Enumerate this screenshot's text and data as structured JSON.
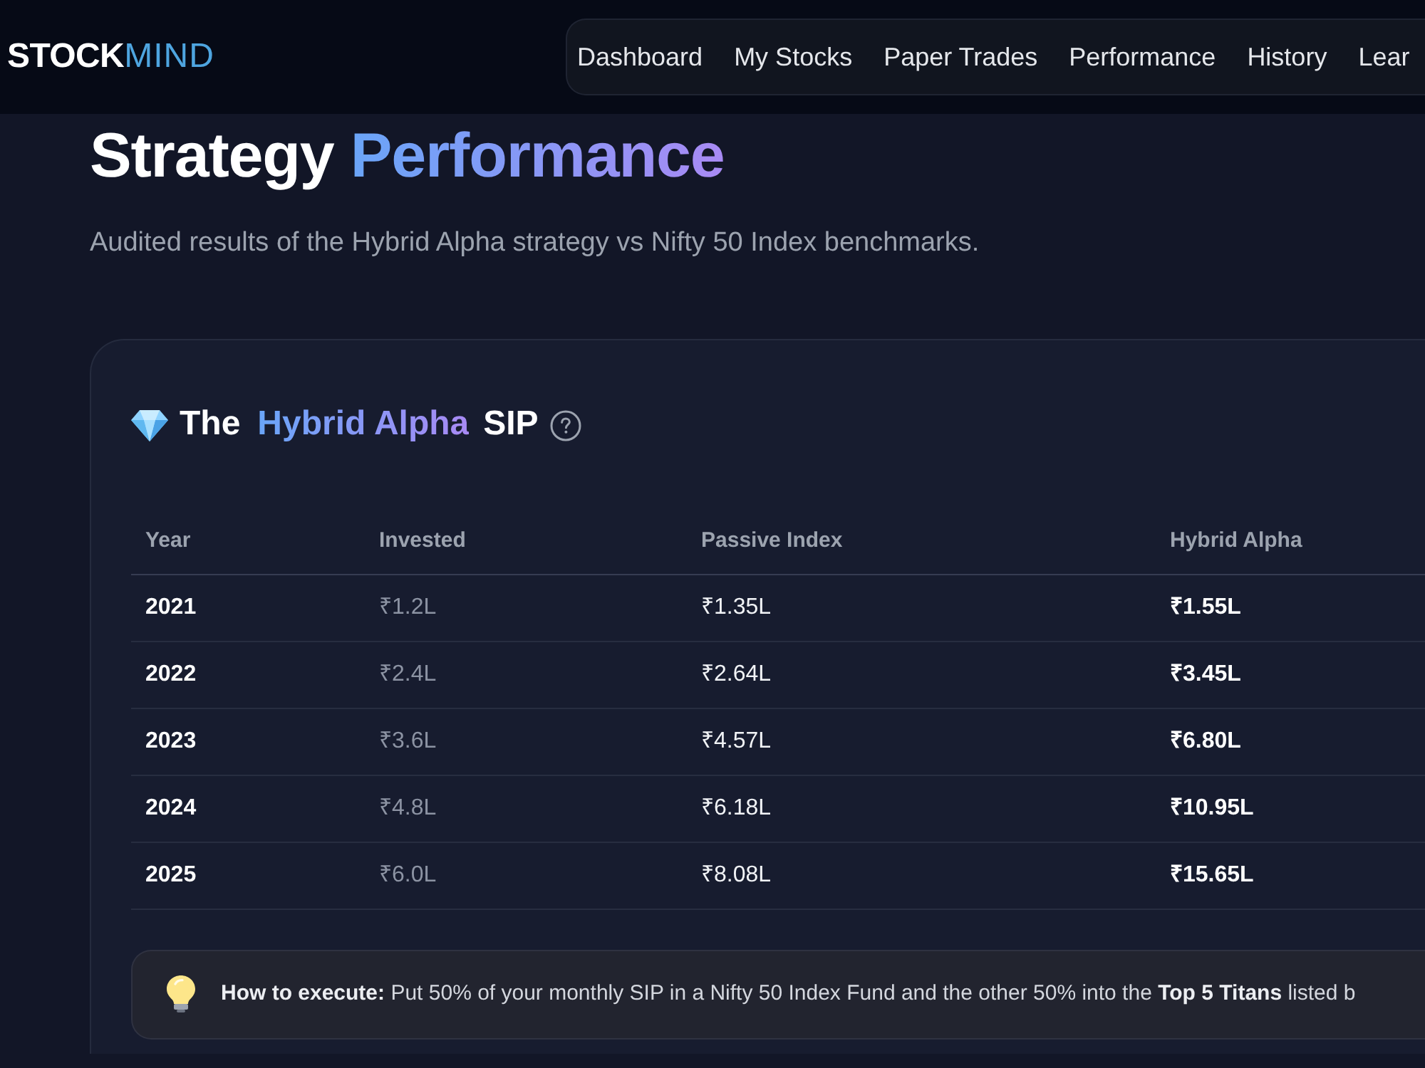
{
  "navbar": {
    "logo": {
      "strong": "STOCK",
      "light": "MIND"
    },
    "links": [
      "Dashboard",
      "My Stocks",
      "Paper Trades",
      "Performance",
      "History",
      "Lear"
    ]
  },
  "header": {
    "title": "Strategy",
    "title_highlight": "Performance",
    "subtitle": "Audited results of the Hybrid Alpha strategy vs Nifty 50 Index benchmarks."
  },
  "sip_card": {
    "heading": {
      "before": "The",
      "highlight": "Hybrid Alpha",
      "after": "SIP"
    },
    "table": {
      "columns": [
        "Year",
        "Invested",
        "Passive Index",
        "Hybrid Alpha"
      ],
      "rows": [
        [
          "2021",
          "₹1.2L",
          "₹1.35L",
          "₹1.55L"
        ],
        [
          "2022",
          "₹2.4L",
          "₹2.64L",
          "₹3.45L"
        ],
        [
          "2023",
          "₹3.6L",
          "₹4.57L",
          "₹6.80L"
        ],
        [
          "2024",
          "₹4.8L",
          "₹6.18L",
          "₹10.95L"
        ],
        [
          "2025",
          "₹6.0L",
          "₹8.08L",
          "₹15.65L"
        ]
      ]
    },
    "tip": {
      "text": "**How to execute:** Put 50% of your monthly SIP in a Nifty 50 Index Fund and the other 50% into the **Top 5 Titans** listed b"
    }
  }
}
